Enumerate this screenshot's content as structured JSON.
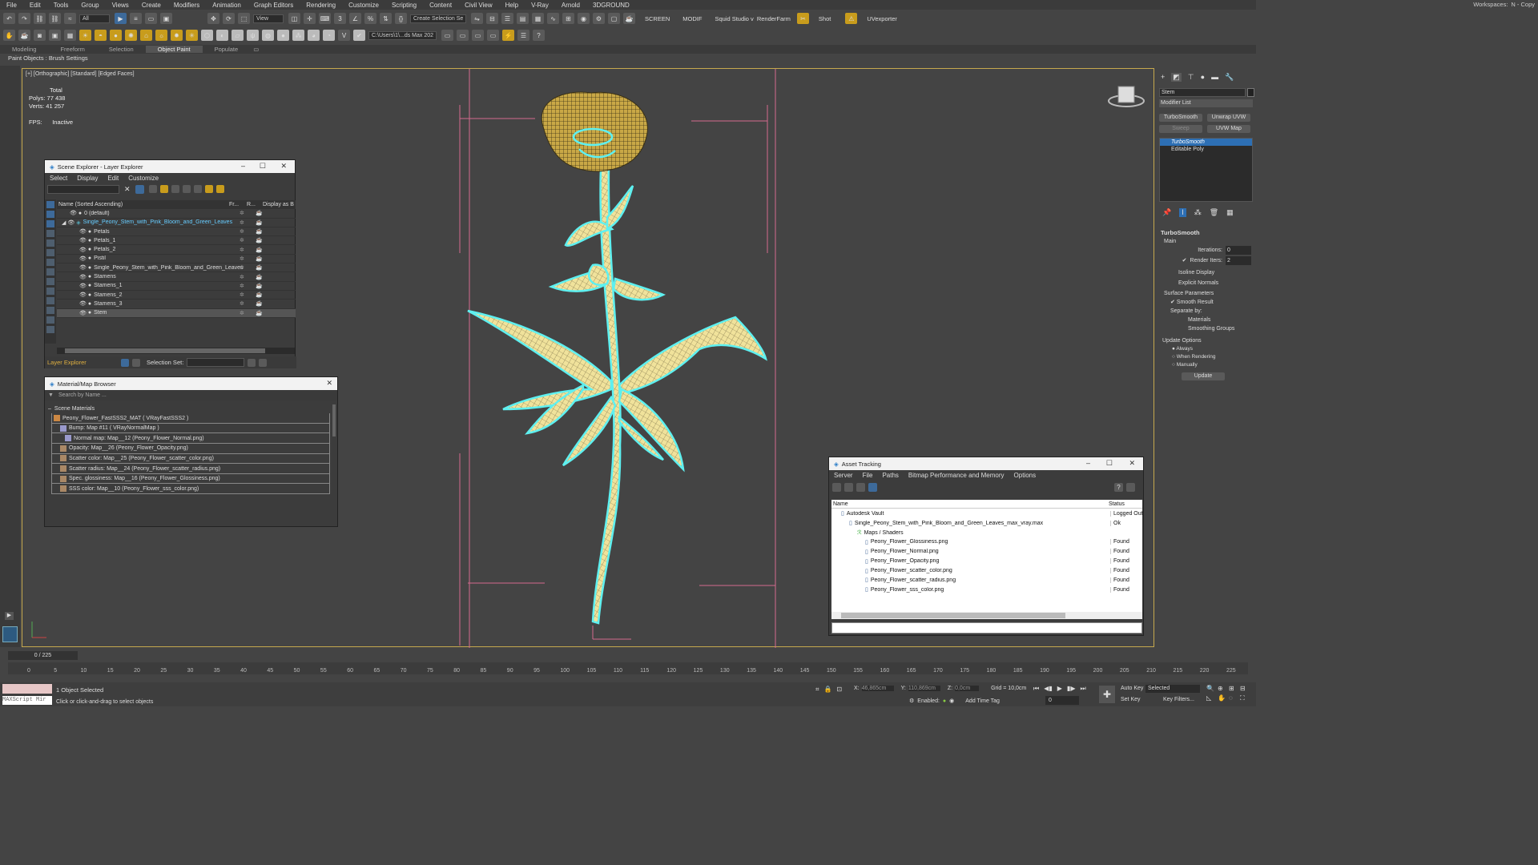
{
  "menu": [
    "File",
    "Edit",
    "Tools",
    "Group",
    "Views",
    "Create",
    "Modifiers",
    "Animation",
    "Graph Editors",
    "Rendering",
    "Customize",
    "Scripting",
    "Content",
    "Civil View",
    "Help",
    "V-Ray",
    "Arnold",
    "3DGROUND"
  ],
  "workspace": {
    "label": "Workspaces:",
    "value": "N - Copy"
  },
  "toolbar": {
    "filter": "All",
    "view_dropdown": "View",
    "selection_set": "Create Selection Se",
    "screen": "SCREEN",
    "modif": "MODIF",
    "squid": "Squid Studio v",
    "renderfarm": "RenderFarm",
    "shot": "Shot",
    "uvexporter": "UVexporter",
    "path": "C:\\Users\\1\\...ds Max 202"
  },
  "ribbon": {
    "tabs": [
      "Modeling",
      "Freeform",
      "Selection",
      "Object Paint",
      "Populate"
    ],
    "active": "Object Paint",
    "sub": "Paint Objects : Brush Settings"
  },
  "viewport": {
    "label": "[+] [Orthographic] [Standard] [Edged Faces]",
    "total": "Total",
    "polys_label": "Polys:",
    "polys": "77 438",
    "verts_label": "Verts:",
    "verts": "41 257",
    "fps_label": "FPS:",
    "fps": "Inactive"
  },
  "scene_explorer": {
    "title": "Scene Explorer - Layer Explorer",
    "menu": [
      "Select",
      "Display",
      "Edit",
      "Customize"
    ],
    "col_name": "Name (Sorted Ascending)",
    "col_fr": "Fr...",
    "col_r": "R...",
    "col_disp": "Display as B",
    "rows": [
      {
        "name": "0 (default)",
        "indent": 1
      },
      {
        "name": "Single_Peony_Stem_with_Pink_Bloom_and_Green_Leaves",
        "indent": 0,
        "layer": true
      },
      {
        "name": "Petals",
        "indent": 2
      },
      {
        "name": "Petals_1",
        "indent": 2
      },
      {
        "name": "Petals_2",
        "indent": 2
      },
      {
        "name": "Pistil",
        "indent": 2
      },
      {
        "name": "Single_Peony_Stem_with_Pink_Bloom_and_Green_Leaves",
        "indent": 2
      },
      {
        "name": "Stamens",
        "indent": 2
      },
      {
        "name": "Stamens_1",
        "indent": 2
      },
      {
        "name": "Stamens_2",
        "indent": 2
      },
      {
        "name": "Stamens_3",
        "indent": 2
      },
      {
        "name": "Stem",
        "indent": 2,
        "sel": true
      }
    ],
    "footer_layer": "Layer Explorer",
    "footer_sel": "Selection Set:"
  },
  "material_browser": {
    "title": "Material/Map Browser",
    "search": "Search by Name ...",
    "section": "Scene Materials",
    "items": [
      "Peony_Flower_FastSSS2_MAT  ( VRayFastSSS2 )",
      "Bump: Map #11  ( VRayNormalMap )",
      "Normal map: Map__12 (Peony_Flower_Normal.png)",
      "Opacity: Map__26 (Peony_Flower_Opacity.png)",
      "Scatter color: Map__25 (Peony_Flower_scatter_color.png)",
      "Scatter radius: Map__24 (Peony_Flower_scatter_radius.png)",
      "Spec. glossiness: Map__16 (Peony_Flower_Glossiness.png)",
      "SSS color: Map__10 (Peony_Flower_sss_color.png)"
    ]
  },
  "asset_tracking": {
    "title": "Asset Tracking",
    "menu": [
      "Server",
      "File",
      "Paths",
      "Bitmap Performance and Memory",
      "Options"
    ],
    "col_name": "Name",
    "col_status": "Status",
    "rows": [
      {
        "name": "Autodesk Vault",
        "status": "Logged Out",
        "indent": 0
      },
      {
        "name": "Single_Peony_Stem_with_Pink_Bloom_and_Green_Leaves_max_vray.max",
        "status": "Ok",
        "indent": 1
      },
      {
        "name": "Maps / Shaders",
        "status": "",
        "indent": 2
      },
      {
        "name": "Peony_Flower_Glossiness.png",
        "status": "Found",
        "indent": 3
      },
      {
        "name": "Peony_Flower_Normal.png",
        "status": "Found",
        "indent": 3
      },
      {
        "name": "Peony_Flower_Opacity.png",
        "status": "Found",
        "indent": 3
      },
      {
        "name": "Peony_Flower_scatter_color.png",
        "status": "Found",
        "indent": 3
      },
      {
        "name": "Peony_Flower_scatter_radius.png",
        "status": "Found",
        "indent": 3
      },
      {
        "name": "Peony_Flower_sss_color.png",
        "status": "Found",
        "indent": 3
      }
    ]
  },
  "command_panel": {
    "object_name": "Stem",
    "modifier_list": "Modifier List",
    "btns": [
      "TurboSmooth",
      "Unwrap UVW",
      "Sweep",
      "UVW Map"
    ],
    "stack": [
      "TurboSmooth",
      "Editable Poly"
    ],
    "ts_title": "TurboSmooth",
    "main": "Main",
    "iterations_label": "Iterations:",
    "iterations": "0",
    "render_iters_label": "Render Iters:",
    "render_iters": "2",
    "isoline": "Isoline Display",
    "explicit": "Explicit Normals",
    "surface": "Surface Parameters",
    "smooth_result": "Smooth Result",
    "separate": "Separate by:",
    "materials": "Materials",
    "smoothing": "Smoothing Groups",
    "update_options": "Update Options",
    "always": "Always",
    "when_rendering": "When Rendering",
    "manually": "Manually",
    "update": "Update"
  },
  "timeline": {
    "frame": "0 / 225",
    "ticks": [
      "0",
      "5",
      "10",
      "15",
      "20",
      "25",
      "30",
      "35",
      "40",
      "45",
      "50",
      "55",
      "60",
      "65",
      "70",
      "75",
      "80",
      "85",
      "90",
      "95",
      "100",
      "105",
      "110",
      "115",
      "120",
      "125",
      "130",
      "135",
      "140",
      "145",
      "150",
      "155",
      "160",
      "165",
      "170",
      "175",
      "180",
      "185",
      "190",
      "195",
      "200",
      "205",
      "210",
      "215",
      "220",
      "225"
    ]
  },
  "status": {
    "maxscript": "MAXScript Mir",
    "selected": "1 Object Selected",
    "hint": "Click or click-and-drag to select objects",
    "x_label": "X:",
    "x": "46,865cm",
    "y_label": "Y:",
    "y": "110,869cm",
    "z_label": "Z:",
    "z": "0,0cm",
    "grid": "Grid = 10,0cm",
    "enabled": "Enabled:",
    "add_time_tag": "Add Time Tag",
    "auto_key": "Auto Key",
    "selected_dd": "Selected",
    "set_key": "Set Key",
    "key_filters": "Key Filters...",
    "frame_input": "0"
  },
  "colors": {
    "accent": "#c6a94e",
    "selection": "#5ef0f0",
    "mesh": "#f0e29b",
    "helper": "#d46a8e"
  }
}
